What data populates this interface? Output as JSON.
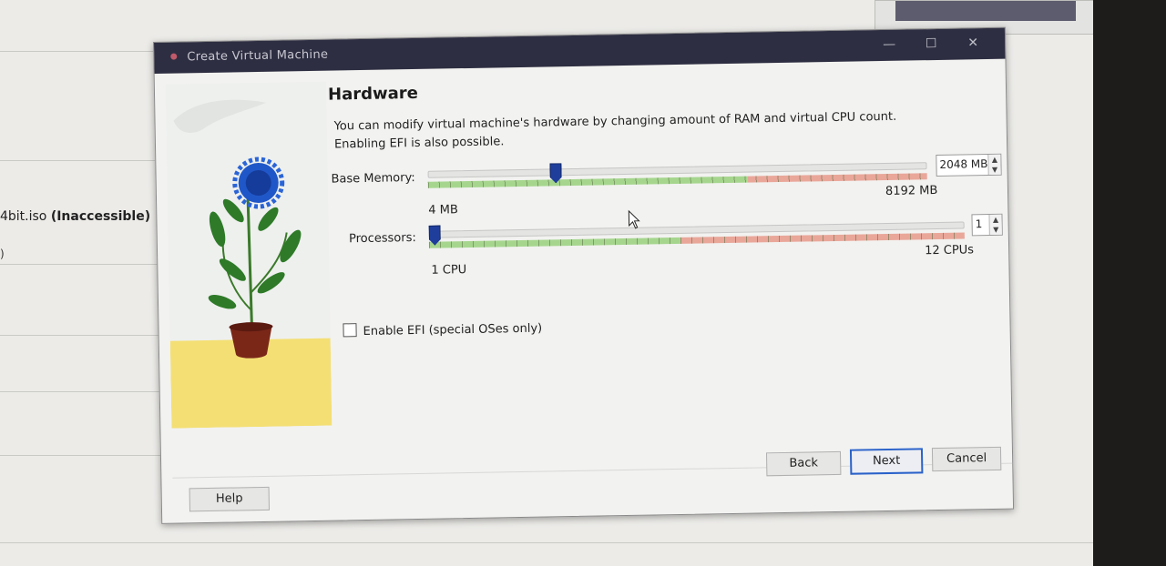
{
  "background": {
    "partial_filename": "4bit.iso",
    "inaccessible_label": "(Inaccessible)",
    "paren": ")"
  },
  "dialog": {
    "title": "Create Virtual Machine",
    "window_controls": {
      "minimize": "—",
      "maximize": "☐",
      "close": "✕"
    },
    "heading": "Hardware",
    "description": "You can modify virtual machine's hardware by changing amount of RAM and virtual CPU count. Enabling EFI is also possible.",
    "memory": {
      "label": "Base Memory:",
      "value": "2048 MB",
      "min_label": "4 MB",
      "max_label": "8192 MB",
      "level": 0.25,
      "green_fraction": 0.64
    },
    "processors": {
      "label": "Processors:",
      "value": "1",
      "min_label": "1 CPU",
      "max_label": "12 CPUs",
      "level": 0.0,
      "green_fraction": 0.47
    },
    "efi_checkbox": {
      "label": "Enable EFI (special OSes only)",
      "checked": false
    },
    "buttons": {
      "help": "Help",
      "back": "Back",
      "next": "Next",
      "cancel": "Cancel"
    }
  },
  "colors": {
    "titlebar": "#2e2e42",
    "slider_thumb": "#1f3e9c",
    "zone_green": "#a6d68e",
    "zone_red": "#e9a79a",
    "next_border": "#2a62c9"
  },
  "icons": [
    "app-icon",
    "minimize-icon",
    "maximize-icon",
    "close-icon",
    "spin-arrows-icon",
    "mouse-cursor-icon"
  ]
}
